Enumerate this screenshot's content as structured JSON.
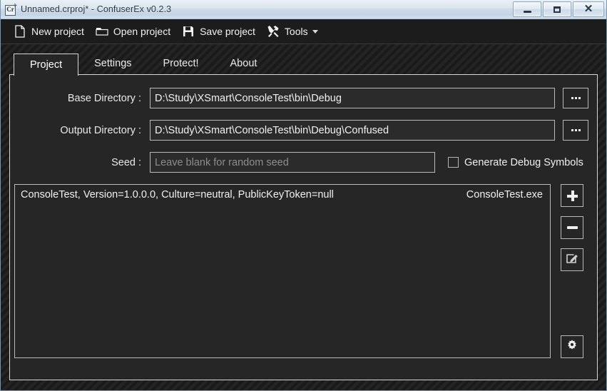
{
  "window": {
    "title": "Unnamed.crproj* - ConfuserEx v0.2.3",
    "icon": "app-logo-icon",
    "caption": {
      "minimize": "minimize-button",
      "maximize": "maximize-button",
      "close": "close-button"
    }
  },
  "toolbar": {
    "items": [
      {
        "label": "New project",
        "icon": "new-file-icon"
      },
      {
        "label": "Open project",
        "icon": "open-folder-icon"
      },
      {
        "label": "Save project",
        "icon": "floppy-save-icon"
      },
      {
        "label": "Tools",
        "icon": "tools-wrench-icon",
        "has_dropdown": true
      }
    ]
  },
  "tabs": [
    {
      "label": "Project",
      "active": true
    },
    {
      "label": "Settings",
      "active": false
    },
    {
      "label": "Protect!",
      "active": false
    },
    {
      "label": "About",
      "active": false
    }
  ],
  "project": {
    "base_directory": {
      "label": "Base Directory :",
      "value": "D:\\Study\\XSmart\\ConsoleTest\\bin\\Debug",
      "placeholder": "",
      "browse_label": "..."
    },
    "output_directory": {
      "label": "Output Directory :",
      "value": "D:\\Study\\XSmart\\ConsoleTest\\bin\\Debug\\Confused",
      "placeholder": "",
      "browse_label": "..."
    },
    "seed": {
      "label": "Seed :",
      "value": "",
      "placeholder": "Leave blank for random seed"
    },
    "debug_symbols": {
      "label": "Generate Debug Symbols",
      "checked": false
    },
    "modules": [
      {
        "assembly": "ConsoleTest, Version=1.0.0.0, Culture=neutral, PublicKeyToken=null",
        "file": "ConsoleTest.exe"
      }
    ],
    "side_buttons": [
      {
        "name": "add-module-button",
        "icon": "plus-icon"
      },
      {
        "name": "remove-module-button",
        "icon": "minus-icon"
      },
      {
        "name": "edit-module-button",
        "icon": "edit-pencil-icon"
      },
      {
        "name": "module-settings-button",
        "icon": "gear-icon"
      }
    ]
  },
  "colors": {
    "panel_bg": "#262626",
    "window_bg": "#1e1e1e",
    "border": "#b9b9b9",
    "text": "#f0f0f0",
    "placeholder": "#8d8d8d",
    "titlebar": "#cfdcea"
  }
}
